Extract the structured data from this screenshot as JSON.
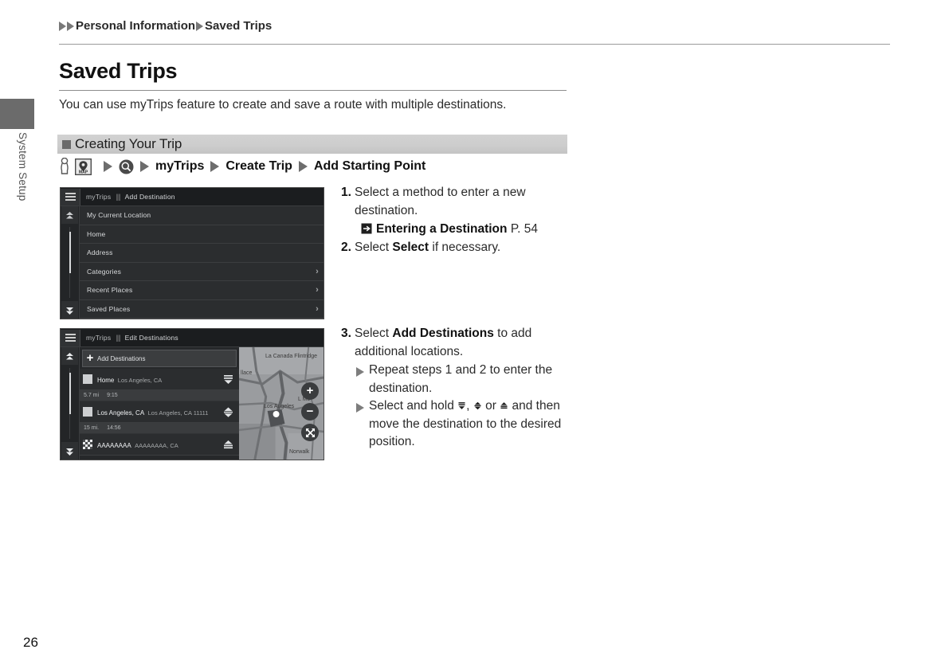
{
  "sidebar": {
    "tab_label": "System Setup"
  },
  "breadcrumb": {
    "item1": "Personal Information",
    "item2": "Saved Trips"
  },
  "page": {
    "title": "Saved Trips",
    "intro": "You can use myTrips feature to create and save a route with multiple destinations.",
    "number": "26"
  },
  "section": {
    "title": "Creating Your Trip"
  },
  "navpath": {
    "icon1": "hand-pointer-icon",
    "icon2": "map-button-icon",
    "icon2_label": "MAP",
    "icon3": "search-circle-icon",
    "step1": "myTrips",
    "step2": "Create Trip",
    "step3": "Add Starting Point"
  },
  "screenshot1": {
    "titlebar": {
      "menu_icon": "hamburger-menu-icon",
      "app": "myTrips",
      "screen": "Add Destination"
    },
    "rows": [
      {
        "label": "My Current Location",
        "chevron": false
      },
      {
        "label": "Home",
        "chevron": false
      },
      {
        "label": "Address",
        "chevron": false
      },
      {
        "label": "Categories",
        "chevron": true
      },
      {
        "label": "Recent Places",
        "chevron": true
      },
      {
        "label": "Saved Places",
        "chevron": true
      }
    ],
    "chevron_glyph": "›"
  },
  "screenshot2": {
    "titlebar": {
      "menu_icon": "hamburger-menu-icon",
      "app": "myTrips",
      "screen": "Edit Destinations"
    },
    "add_button": {
      "label": "Add Destinations",
      "icon": "plus-icon"
    },
    "destinations": [
      {
        "icon": "flag-icon",
        "name": "Home",
        "address": "Los Angeles, CA",
        "handle": "move-down-handle-icon"
      },
      {
        "icon": "flag-icon",
        "name": "Los Angeles, CA",
        "address": "Los Angeles, CA 11111",
        "handle": "move-updown-handle-icon"
      },
      {
        "icon": "checkered-flag-icon",
        "name": "AAAAAAAA",
        "address": "AAAAAAAA, CA",
        "handle": "move-up-handle-icon"
      }
    ],
    "segments": [
      {
        "distance": "5.7 mi",
        "time": "9:15"
      },
      {
        "distance": "15 mi.",
        "time": "14:56"
      }
    ],
    "map": {
      "labels": [
        "La Canada Flintridge",
        "llace",
        "Los Angeles",
        "Norwalk",
        "L Mo"
      ],
      "zoom_in": "+",
      "zoom_out": "−",
      "expand": "expand-icon"
    }
  },
  "instructions_top": {
    "step1_num": "1.",
    "step1_a": "Select a method to enter a new destination.",
    "ref_icon": "reference-arrow-icon",
    "ref_bold": "Entering a Destination",
    "ref_page": "P. 54",
    "step2_num": "2.",
    "step2_a": "Select ",
    "step2_bold": "Select",
    "step2_b": " if necessary."
  },
  "instructions_bottom": {
    "step3_num": "3.",
    "step3_a": "Select ",
    "step3_bold": "Add Destinations",
    "step3_b": " to add additional locations.",
    "bullet1": "Repeat steps 1 and 2 to enter the destination.",
    "bullet2_a": "Select and hold ",
    "bullet2_sep1": ", ",
    "bullet2_sep2": " or ",
    "bullet2_b": " and then move the destination to the desired position."
  }
}
